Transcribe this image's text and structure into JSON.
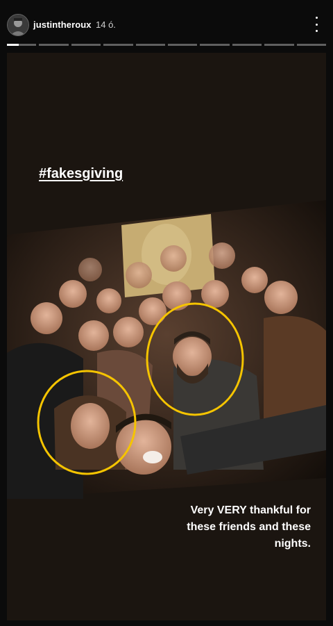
{
  "header": {
    "username": "justintheroux",
    "timestamp": "14 ó.",
    "avatar_icon": "user-avatar",
    "more_icon": "more-vertical-icon"
  },
  "progress": {
    "segments": 10,
    "active_index": 0,
    "active_fraction": 0.4
  },
  "story": {
    "hashtag": "#fakesgiving",
    "caption_lines": [
      "Very VERY thankful for",
      "these friends and these",
      "nights."
    ],
    "highlight_color": "#f5c400"
  }
}
